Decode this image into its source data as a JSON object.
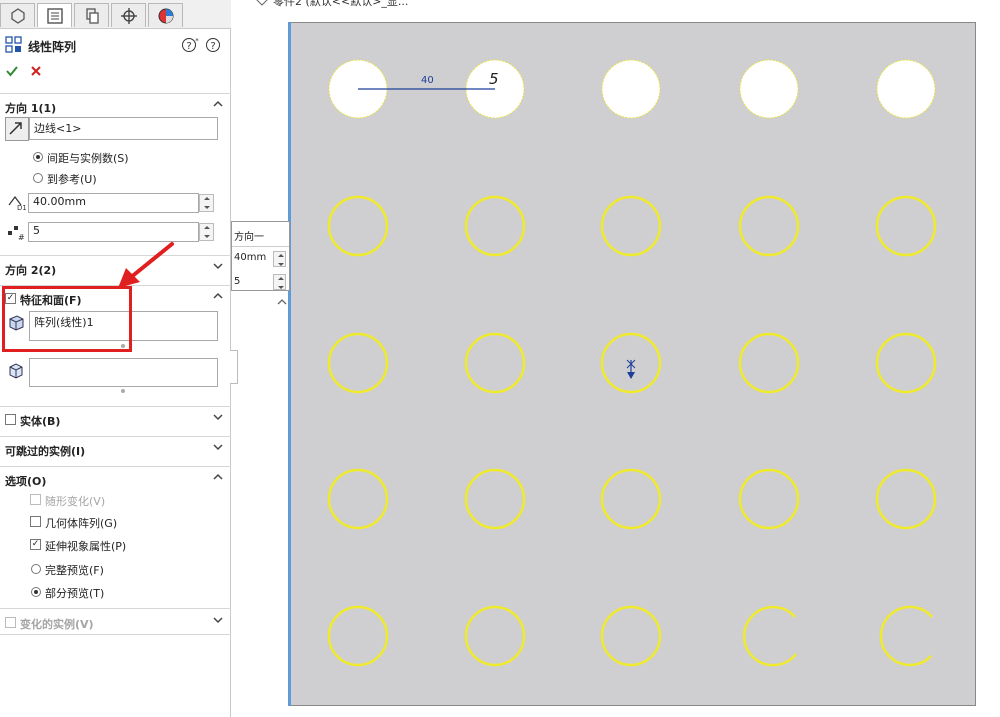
{
  "feature_manager": {
    "title": "线性阵列",
    "direction1": {
      "header": "方向 1(1)",
      "edge_value": "边线<1>",
      "option_spacing": "间距与实例数(S)",
      "option_reference": "到参考(U)",
      "spacing_value": "40.00mm",
      "count_value": "5"
    },
    "direction2": {
      "header": "方向 2(2)"
    },
    "features": {
      "header": "特征和面(F)",
      "list_value": "阵列(线性)1"
    },
    "bodies": {
      "header": "实体(B)"
    },
    "skip": {
      "header": "可跳过的实例(I)"
    },
    "options": {
      "header": "选项(O)",
      "vary_sketch": "随形变化(V)",
      "geometry_pattern": "几何体阵列(G)",
      "propagate": "延伸视象属性(P)",
      "full_preview": "完整预览(F)",
      "partial_preview": "部分预览(T)"
    },
    "varied": {
      "header": "变化的实例(V)"
    }
  },
  "viewport": {
    "top_title": "零件2 (默认<<默认>_显...",
    "dim_spacing": "40",
    "dim_count": "5",
    "popup": {
      "title": "方向一",
      "spacing": "40mm",
      "count": "5"
    }
  },
  "colors": {
    "hole_outline": "#e8e23a",
    "sheet": "#cfcfd1",
    "accent_blue": "#1e3f99",
    "highlight_red": "#e02020"
  }
}
